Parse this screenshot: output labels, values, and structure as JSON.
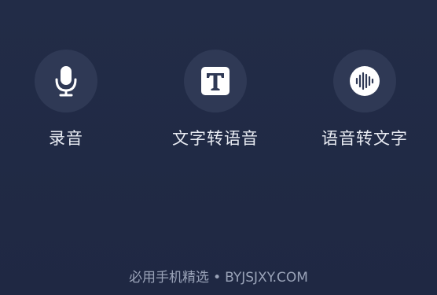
{
  "features": [
    {
      "label": "录音",
      "icon": "microphone-icon"
    },
    {
      "label": "文字转语音",
      "icon": "text-t-icon"
    },
    {
      "label": "语音转文字",
      "icon": "sound-wave-icon"
    }
  ],
  "watermark": {
    "site_name": "必用手机精选",
    "separator": "•",
    "domain": "BYJSJXY.COM"
  },
  "colors": {
    "background": "#1f2944",
    "icon_circle": "#2f3955",
    "icon_foreground": "#ffffff",
    "label_text": "#e9ecf3",
    "watermark_text": "#9aa3b8"
  }
}
